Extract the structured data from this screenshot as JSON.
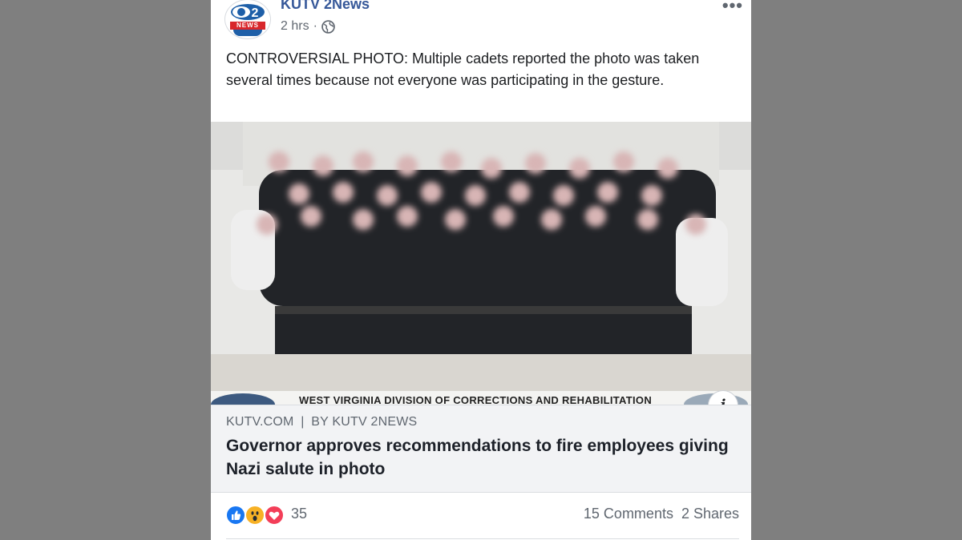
{
  "post": {
    "page_name": "KUTV 2News",
    "timestamp": "2 hrs",
    "separator": "·",
    "privacy_icon": "globe-icon",
    "more_icon": "more-options-icon",
    "more_label": "•••",
    "text": "CONTROVERSIAL PHOTO: Multiple cadets reported the photo was taken several times because not everyone was participating in the gesture."
  },
  "logo": {
    "band_text": "NEWS",
    "brand_blue": "#1e5fa8",
    "brand_red": "#d8262b"
  },
  "photo": {
    "caption_line": "WEST VIRGINIA DIVISION OF CORRECTIONS AND REHABILITATION",
    "info_label": "i"
  },
  "link": {
    "source": "KUTV.COM",
    "divider": "|",
    "byline": "BY KUTV 2NEWS",
    "headline": "Governor approves recommendations to fire employees giving Nazi salute in photo"
  },
  "footer": {
    "reaction_icons": [
      "like-icon",
      "wow-icon",
      "love-icon"
    ],
    "reaction_count": "35",
    "comments": "15 Comments",
    "shares": "2 Shares"
  },
  "colors": {
    "background": "#7f7f7f",
    "link_name": "#365899",
    "meta_text": "#606770",
    "like": "#1877f2",
    "love": "#f33e58",
    "wow": "#f7b125"
  }
}
